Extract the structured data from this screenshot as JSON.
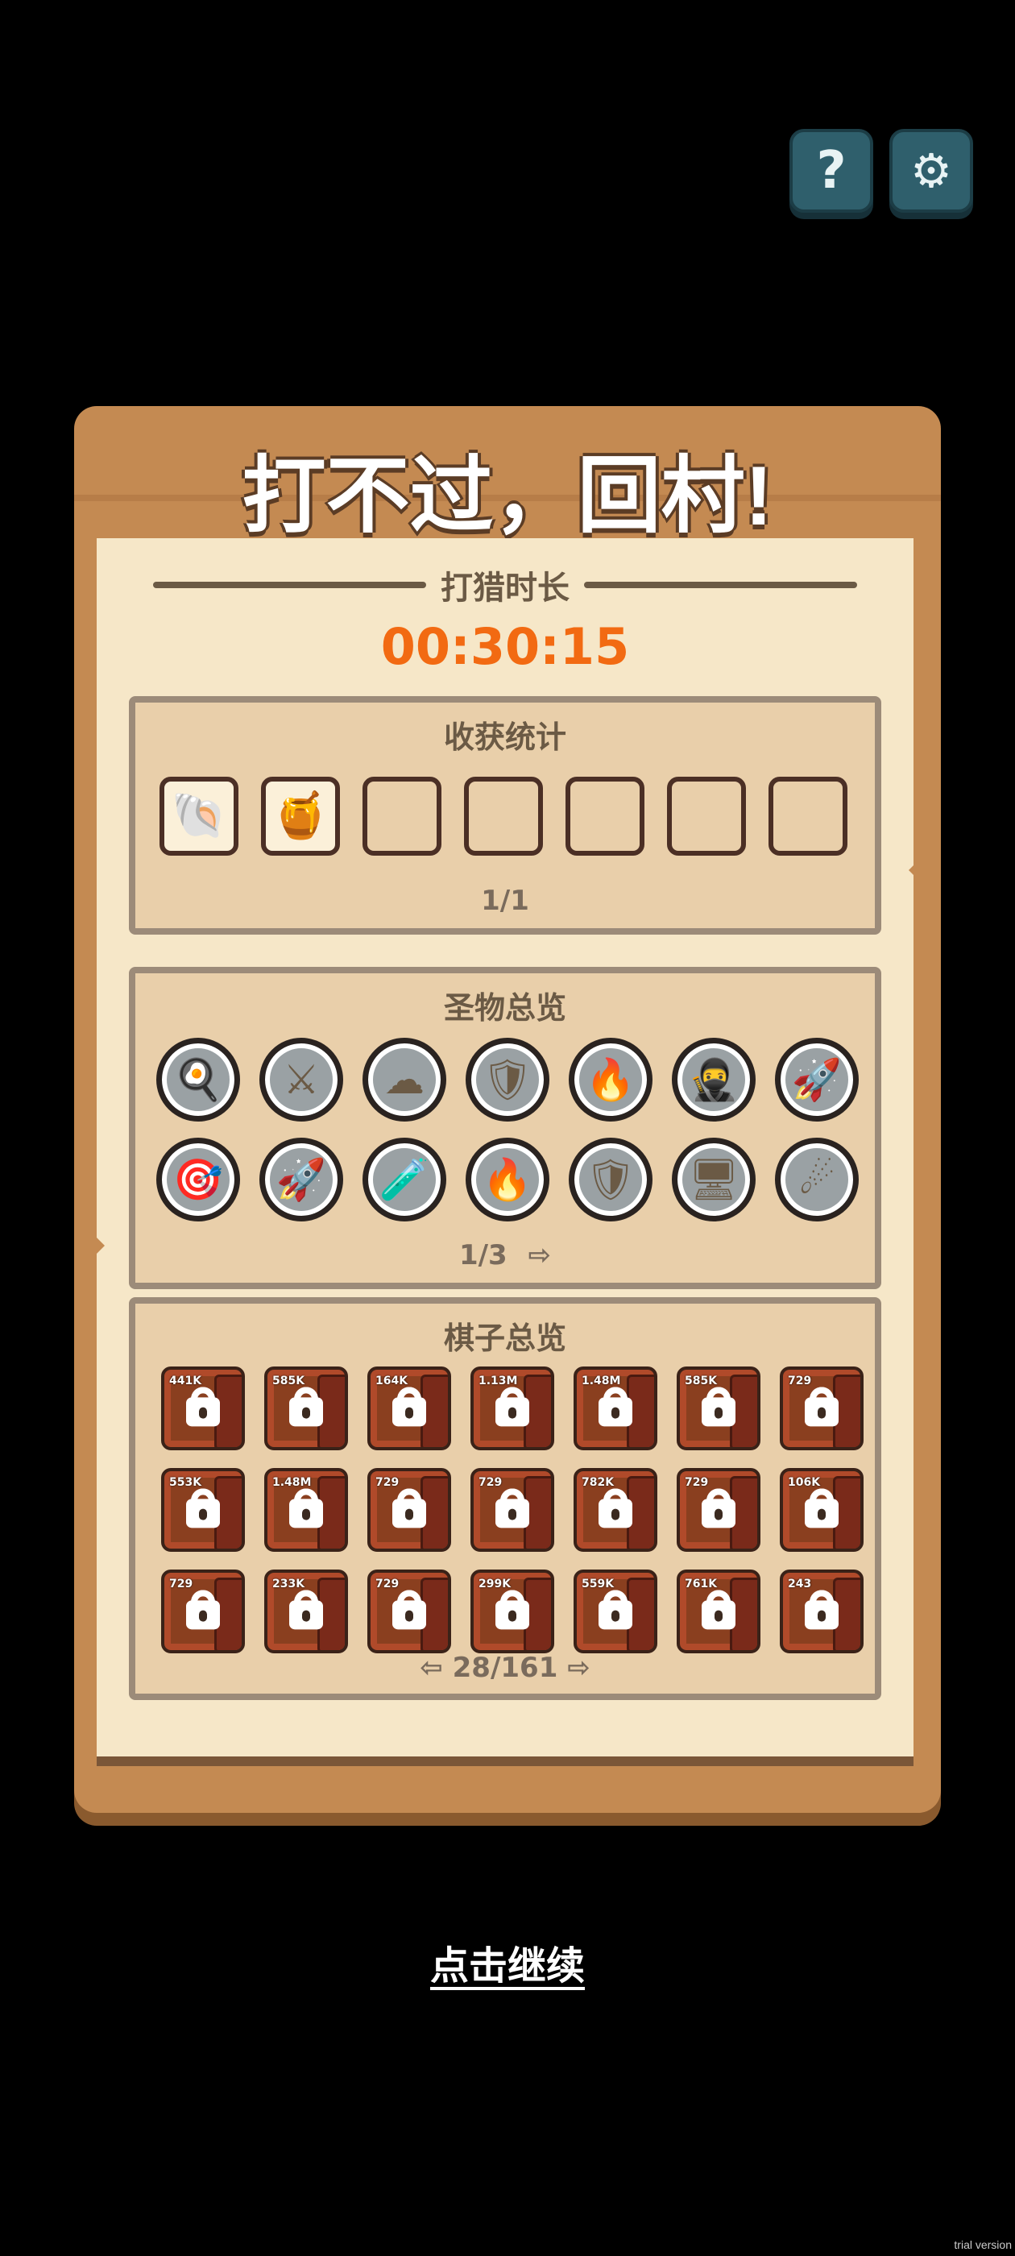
{
  "top_buttons": {
    "help_icon": "question-mark",
    "settings_icon": "gear"
  },
  "panel": {
    "title": "打不过，回村!",
    "duration_label": "打猎时长",
    "duration_value": "00:30:15"
  },
  "harvest": {
    "title": "收获统计",
    "slots": [
      {
        "icon": "clam-shell",
        "glyph": "🐚",
        "filled": true
      },
      {
        "icon": "honey-jar",
        "glyph": "🍯",
        "filled": true
      },
      {
        "filled": false
      },
      {
        "filled": false
      },
      {
        "filled": false
      },
      {
        "filled": false
      },
      {
        "filled": false
      }
    ],
    "count": "1/1"
  },
  "relics": {
    "title": "圣物总览",
    "items": [
      {
        "icon": "spatula-icon",
        "glyph": "🍳"
      },
      {
        "icon": "crossed-swords-icon",
        "glyph": "⚔"
      },
      {
        "icon": "coin-cloud-icon",
        "glyph": "☁"
      },
      {
        "icon": "armored-knight-icon",
        "glyph": "🛡"
      },
      {
        "icon": "flaming-sword-icon",
        "glyph": "🔥"
      },
      {
        "icon": "ninja-icon",
        "glyph": "🥷"
      },
      {
        "icon": "rocket-sword-icon",
        "glyph": "🚀"
      },
      {
        "icon": "crosshair-map-icon",
        "glyph": "🎯"
      },
      {
        "icon": "rocket-icon",
        "glyph": "🚀"
      },
      {
        "icon": "potion-icon",
        "glyph": "🧪"
      },
      {
        "icon": "fire-icon",
        "glyph": "🔥"
      },
      {
        "icon": "shields-icon",
        "glyph": "🛡"
      },
      {
        "icon": "machine-icon",
        "glyph": "🖥"
      },
      {
        "icon": "fireball-icon",
        "glyph": "☄"
      }
    ],
    "page": "1/3"
  },
  "pieces": {
    "title": "棋子总览",
    "items": [
      {
        "text": "441K"
      },
      {
        "text": "585K"
      },
      {
        "text": "164K"
      },
      {
        "text": "1.13M"
      },
      {
        "text": "1.48M"
      },
      {
        "text": "585K"
      },
      {
        "text": "729"
      },
      {
        "text": "553K"
      },
      {
        "text": "1.48M"
      },
      {
        "text": "729"
      },
      {
        "text": "729"
      },
      {
        "text": "782K"
      },
      {
        "text": "729"
      },
      {
        "text": "106K"
      },
      {
        "text": "729"
      },
      {
        "text": "233K"
      },
      {
        "text": "729"
      },
      {
        "text": "299K"
      },
      {
        "text": "559K"
      },
      {
        "text": "761K"
      },
      {
        "text": "243"
      }
    ],
    "page": "28/161"
  },
  "continue_label": "点击继续",
  "watermark": "trial version"
}
